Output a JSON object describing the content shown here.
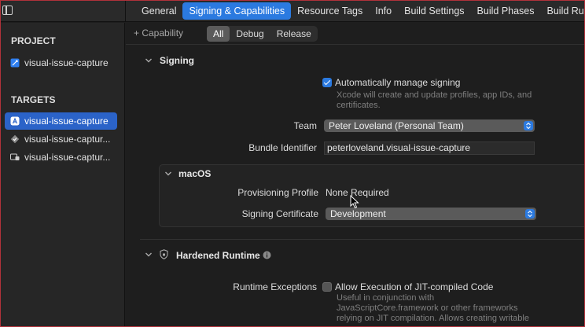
{
  "tabs": [
    {
      "label": "General"
    },
    {
      "label": "Signing & Capabilities"
    },
    {
      "label": "Resource Tags"
    },
    {
      "label": "Info"
    },
    {
      "label": "Build Settings"
    },
    {
      "label": "Build Phases"
    },
    {
      "label": "Build Rules"
    }
  ],
  "active_tab": "Signing & Capabilities",
  "sidebar": {
    "project_title": "PROJECT",
    "project_item": "visual-issue-capture",
    "targets_title": "TARGETS",
    "targets": [
      {
        "label": "visual-issue-capture",
        "icon": "app-icon",
        "selected": true
      },
      {
        "label": "visual-issue-captur...",
        "icon": "test-bundle-icon",
        "selected": false
      },
      {
        "label": "visual-issue-captur...",
        "icon": "ui-test-icon",
        "selected": false
      }
    ]
  },
  "capbar": {
    "add_label": "+ Capability",
    "filters": [
      "All",
      "Debug",
      "Release"
    ],
    "selected_filter": "All"
  },
  "signing": {
    "title": "Signing",
    "auto_manage_label": "Automatically manage signing",
    "auto_manage_checked": true,
    "auto_manage_help_1": "Xcode will create and update profiles, app IDs, and",
    "auto_manage_help_2": "certificates.",
    "team_label": "Team",
    "team_value": "Peter Loveland (Personal Team)",
    "bundle_label": "Bundle Identifier",
    "bundle_value": "peterloveland.visual-issue-capture",
    "macos": {
      "title": "macOS",
      "profile_label": "Provisioning Profile",
      "profile_value": "None Required",
      "certificate_label": "Signing Certificate",
      "certificate_value": "Development"
    }
  },
  "hardened": {
    "title": "Hardened Runtime",
    "exceptions_label": "Runtime Exceptions",
    "jit_label": "Allow Execution of JIT-compiled Code",
    "jit_checked": false,
    "jit_help_1": "Useful in conjunction with",
    "jit_help_2": "JavaScriptCore.framework or other frameworks",
    "jit_help_3": "relying on JIT compilation. Allows creating writable"
  },
  "colors": {
    "accent": "#2b7ae0",
    "selection": "#2b63c8",
    "frame": "#b0323a"
  }
}
